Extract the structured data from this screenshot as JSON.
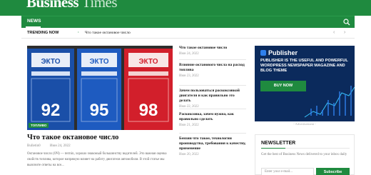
{
  "site": {
    "logo_bold": "Business",
    "logo_thin": "Times"
  },
  "nav": {
    "items": [
      {
        "label": "NEWS"
      }
    ],
    "search_icon": "search-icon"
  },
  "trending": {
    "label": "TRENDING NOW",
    "arrow": "›",
    "headline": "Что такое октановое число",
    "prev": "‹",
    "next": "›"
  },
  "featured": {
    "category": "ТОПЛИВО",
    "title": "Что такое октановое число",
    "author": "Bulletin0",
    "date": "Июн 24, 2022",
    "excerpt": "Октановое число (ОЧ) — termin, хорошо знакомый большинству водителей. Это важная оценка свойств топлива, которое напрямую влияет на работу двигателя автомобиля. В этой статье мы выясните ответы на все..."
  },
  "list": [
    {
      "title": "Что такое октановое число",
      "date": "Июн 24, 2022"
    },
    {
      "title": "Влияние октанового числа на расход топлива",
      "date": "Июн 23, 2022"
    },
    {
      "title": "Зачем пользоваться раскоксовкой двигателя и как правильно это делать",
      "date": "Июн 22, 2022"
    },
    {
      "title": "Раскоксовка, зачем нужна, как правильно сделать",
      "date": "Июн 21, 2022"
    },
    {
      "title": "Бензин что такое, технологии производства, требования к качеству, применение",
      "date": "Июн 20, 2022"
    }
  ],
  "ad": {
    "brand": "Publisher",
    "tagline": "PUBLISHER IS THE USEFUL AND POWERFUL WORDPRESS NEWSPAPER MAGAZINE AND BLOG THEME",
    "button": "BUY NOW",
    "caption": "- Advertisement -"
  },
  "newsletter": {
    "title": "NEWSLETTER",
    "text": "Get the best of Business News delivered to your inbox daily",
    "placeholder": "Enter your e-mail...",
    "button": "Subscribe"
  },
  "pumps": [
    {
      "brand": "ЭКТО",
      "octane": "92"
    },
    {
      "brand": "ЭКТО",
      "octane": "95"
    },
    {
      "brand": "ЭКТО",
      "octane": "98"
    }
  ],
  "colors": {
    "brand_green": "#1f8a3f",
    "ad_blue": "#0b2a5c"
  }
}
